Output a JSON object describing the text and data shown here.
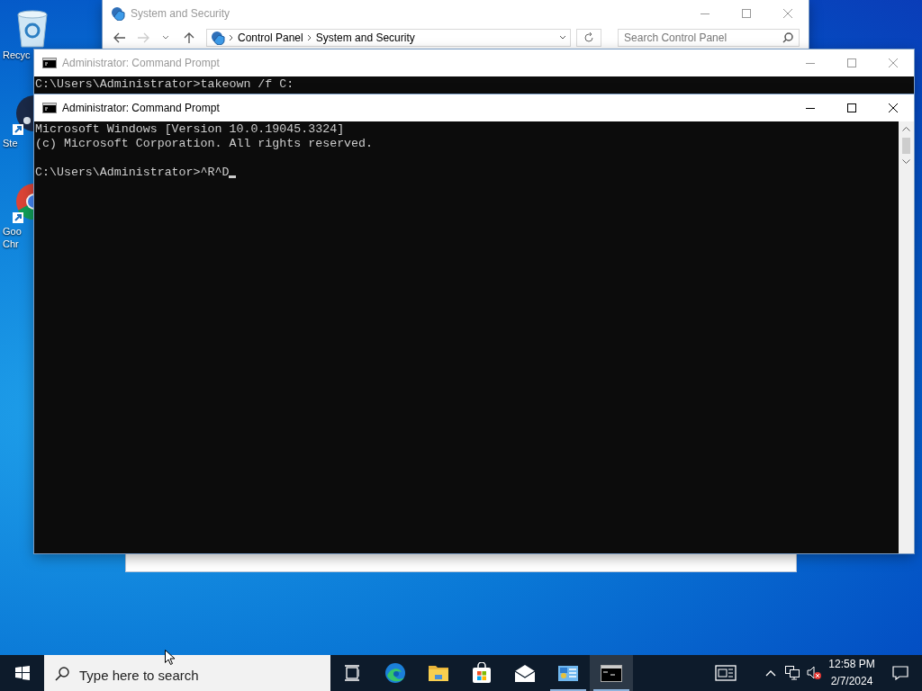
{
  "desktop_icons": [
    {
      "kind": "recycle-bin",
      "label_lines": [
        "Recyc"
      ]
    },
    {
      "kind": "steam",
      "label_lines": [
        "Ste"
      ]
    },
    {
      "kind": "chrome",
      "label_lines": [
        "Goo",
        "Chr"
      ]
    }
  ],
  "windows": [
    {
      "kind": "explorer",
      "title": "System and Security",
      "active": false,
      "address": [
        "Control Panel",
        "System and Security"
      ],
      "search_placeholder": "Search Control Panel"
    },
    {
      "kind": "console",
      "title": "Administrator: Command Prompt",
      "active": false,
      "prompt": "C:\\Users\\Administrator>takeown /f C:",
      "cursor": false
    },
    {
      "kind": "console",
      "title": "Administrator: Command Prompt",
      "active": true,
      "output": [
        "Microsoft Windows [Version 10.0.19045.3324]",
        "(c) Microsoft Corporation. All rights reserved."
      ],
      "prompt": "C:\\Users\\Administrator>^R^D",
      "cursor": true
    }
  ],
  "taskbar": {
    "search_placeholder": "Type here to search",
    "apps": [
      {
        "kind": "task-view",
        "running": false,
        "selected": false
      },
      {
        "kind": "edge",
        "running": false,
        "selected": false
      },
      {
        "kind": "folder",
        "running": false,
        "selected": false
      },
      {
        "kind": "store",
        "running": false,
        "selected": false
      },
      {
        "kind": "mail",
        "running": false,
        "selected": false
      },
      {
        "kind": "control-panel",
        "running": true,
        "selected": false
      },
      {
        "kind": "console",
        "running": true,
        "selected": true
      }
    ],
    "time": "12:58 PM",
    "date": "2/7/2024"
  }
}
